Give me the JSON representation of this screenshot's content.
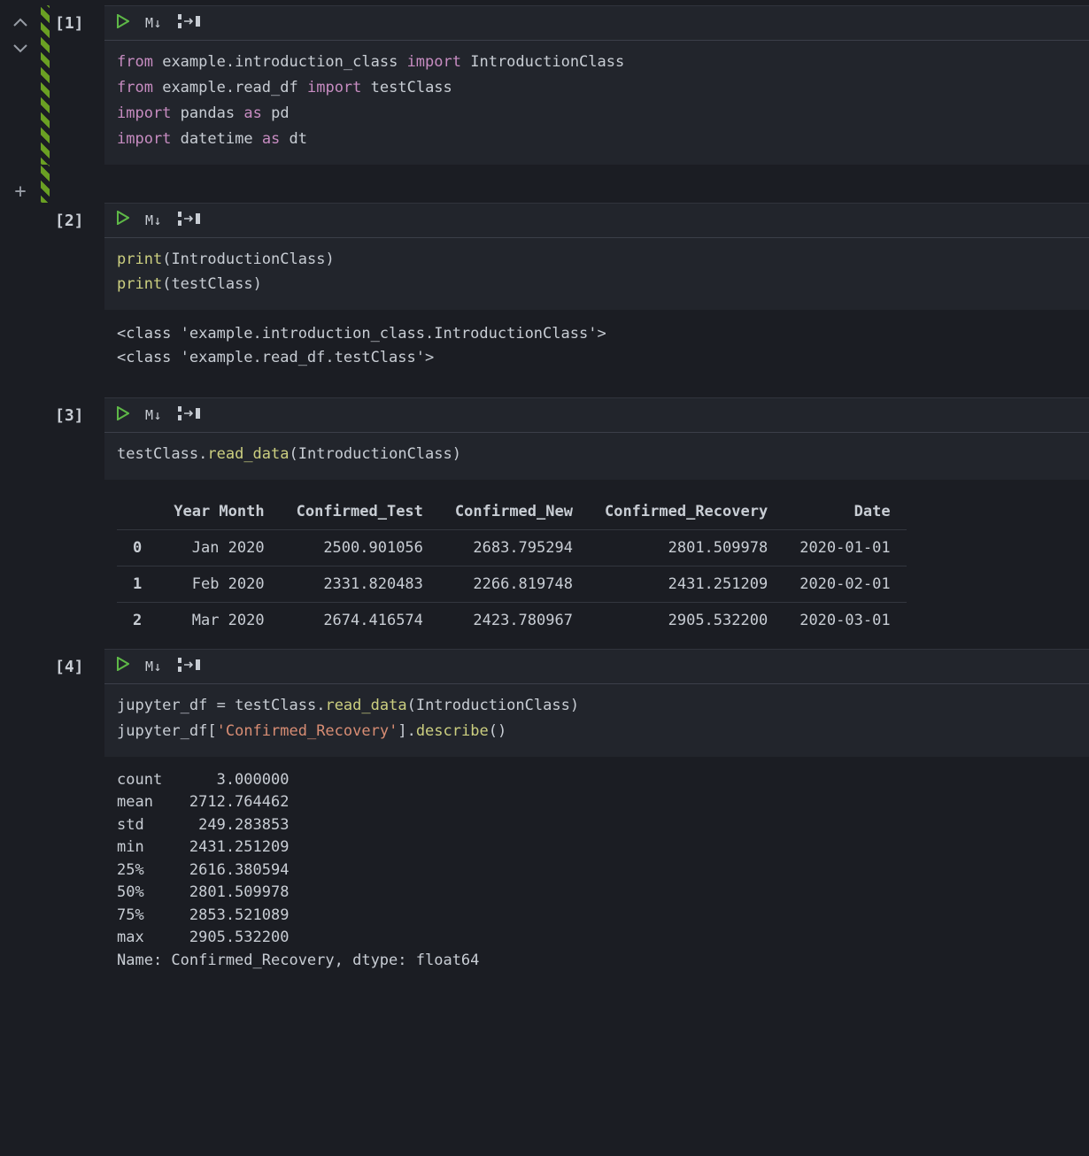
{
  "gutter": {
    "add_cell": "+"
  },
  "toolbar": {
    "play": "▷",
    "markdown": "M↓",
    "split": "⎋→⎋"
  },
  "cells": {
    "c1": {
      "label": "[1]",
      "tok": {
        "from1": "from",
        "mod1": "example.introduction_class",
        "imp1": "import",
        "cls1": "IntroductionClass",
        "from2": "from",
        "mod2": "example.read_df",
        "imp2": "import",
        "cls2": "testClass",
        "imp3": "import",
        "mod3": "pandas",
        "as3": "as",
        "alias3": "pd",
        "imp4": "import",
        "mod4": "datetime",
        "as4": "as",
        "alias4": "dt"
      }
    },
    "c2": {
      "label": "[2]",
      "tok": {
        "fn1": "print",
        "arg1": "IntroductionClass",
        "fn2": "print",
        "arg2": "testClass"
      },
      "output": "<class 'example.introduction_class.IntroductionClass'>\n<class 'example.read_df.testClass'>"
    },
    "c3": {
      "label": "[3]",
      "tok": {
        "obj": "testClass",
        "dot": ".",
        "method": "read_data",
        "arg": "IntroductionClass"
      },
      "df": {
        "columns": [
          "",
          "Year Month",
          "Confirmed_Test",
          "Confirmed_New",
          "Confirmed_Recovery",
          "Date"
        ],
        "rows": [
          [
            "0",
            "Jan 2020",
            "2500.901056",
            "2683.795294",
            "2801.509978",
            "2020-01-01"
          ],
          [
            "1",
            "Feb 2020",
            "2331.820483",
            "2266.819748",
            "2431.251209",
            "2020-02-01"
          ],
          [
            "2",
            "Mar 2020",
            "2674.416574",
            "2423.780967",
            "2905.532200",
            "2020-03-01"
          ]
        ]
      }
    },
    "c4": {
      "label": "[4]",
      "tok": {
        "l1_lhs": "jupyter_df",
        "l1_eq": " = ",
        "l1_obj": "testClass",
        "l1_dot": ".",
        "l1_method": "read_data",
        "l1_arg": "IntroductionClass",
        "l2_obj": "jupyter_df",
        "l2_str": "'Confirmed_Recovery'",
        "l2_dot": ".",
        "l2_method": "describe"
      },
      "describe": {
        "rows": [
          [
            "count",
            "      3.000000"
          ],
          [
            "mean ",
            "   2712.764462"
          ],
          [
            "std  ",
            "    249.283853"
          ],
          [
            "min  ",
            "   2431.251209"
          ],
          [
            "25%  ",
            "   2616.380594"
          ],
          [
            "50%  ",
            "   2801.509978"
          ],
          [
            "75%  ",
            "   2853.521089"
          ],
          [
            "max  ",
            "   2905.532200"
          ]
        ],
        "footer": "Name: Confirmed_Recovery, dtype: float64"
      }
    }
  }
}
